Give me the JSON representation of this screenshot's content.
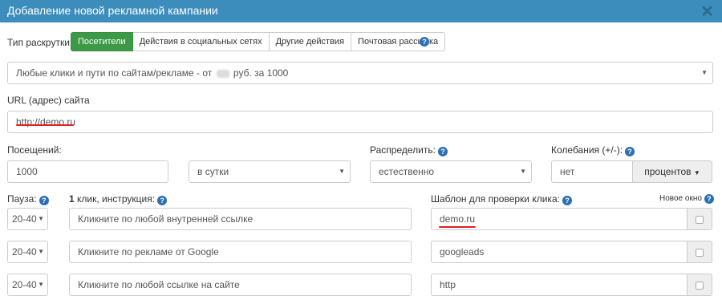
{
  "header": {
    "title": "Добавление новой рекламной кампании",
    "close_label": "✕"
  },
  "promo_type": {
    "label": "Тип раскрутки:",
    "tabs": [
      {
        "label": "Посетители",
        "active": true
      },
      {
        "label": "Действия в социальных сетях",
        "active": false
      },
      {
        "label": "Другие действия",
        "active": false
      },
      {
        "label": "Почтовая рассылка",
        "active": false
      }
    ]
  },
  "mode_select": {
    "value_prefix": "Любые клики и пути по сайтам/рекламе - от",
    "value_suffix": "руб. за 1000"
  },
  "url": {
    "label": "URL (адрес) сайта",
    "value": "http://demo.ru"
  },
  "visits": {
    "label": "Посещений:",
    "value": "1000",
    "period": "в сутки"
  },
  "distribute": {
    "label": "Распределить:",
    "value": "естественно"
  },
  "fluctuation": {
    "label": "Колебания (+/-):",
    "value": "нет",
    "unit": "процентов"
  },
  "pause": {
    "label": "Пауза:"
  },
  "instruction": {
    "label_bold": "1",
    "label_rest": "клик, инструкция:"
  },
  "pattern": {
    "label": "Шаблон для проверки клика:"
  },
  "new_window": {
    "label": "Новое окно"
  },
  "rows": [
    {
      "pause": "20-40",
      "instruction": "Кликните по любой внутренней ссылке",
      "pattern": "demo.ru"
    },
    {
      "pause": "20-40",
      "instruction": "Кликните по рекламе от Google",
      "pattern": "googleads"
    },
    {
      "pause": "20-40",
      "instruction": "Кликните по любой ссылке на сайте",
      "pattern": "http"
    }
  ],
  "colors": {
    "header": "#3c8dbc",
    "active_tab": "#3c9a46",
    "help_icon": "#2c6fb5",
    "underline": "#e02020"
  }
}
